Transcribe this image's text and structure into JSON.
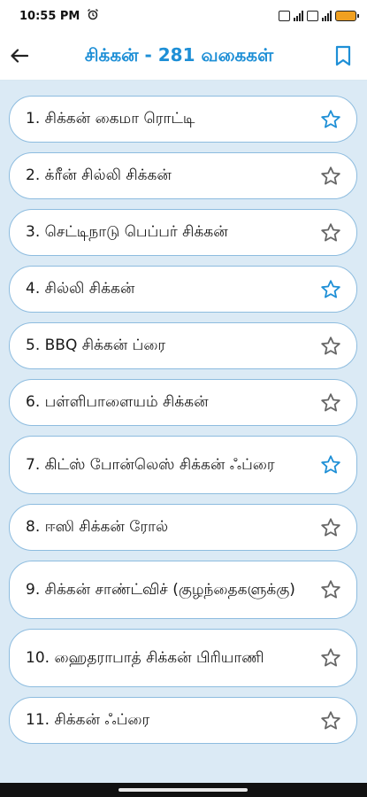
{
  "status_bar": {
    "time": "10:55 PM",
    "alarm_icon": "alarm-clock-icon"
  },
  "header": {
    "title": "சிக்கன் - 281 வகைகள்",
    "back_icon": "arrow-left-icon",
    "bookmark_icon": "bookmark-icon",
    "accent_color": "#1e8fd6"
  },
  "recipes": [
    {
      "label": "1. சிக்கன் கைமா ரொட்டி",
      "favorite": true
    },
    {
      "label": "2. க்ரீன் சில்லி சிக்கன்",
      "favorite": false
    },
    {
      "label": "3. செட்டிநாடு பெப்பர் சிக்கன்",
      "favorite": false
    },
    {
      "label": "4. சில்லி சிக்கன்",
      "favorite": true
    },
    {
      "label": "5. BBQ சிக்கன் ப்ரை",
      "favorite": false
    },
    {
      "label": "6. பள்ளிபாளையம் சிக்கன்",
      "favorite": false
    },
    {
      "label": "7. கிட்ஸ் போன்லெஸ் சிக்கன் ஃப்ரை",
      "favorite": true
    },
    {
      "label": "8. ஈஸி சிக்கன் ரோல்",
      "favorite": false
    },
    {
      "label": "9. சிக்கன் சாண்ட்விச் (குழந்தைகளுக்கு)",
      "favorite": false
    },
    {
      "label": "10. ஹைதராபாத் சிக்கன் பிரியாணி",
      "favorite": false
    },
    {
      "label": "11. சிக்கன் ஃப்ரை",
      "favorite": false
    }
  ],
  "colors": {
    "list_background": "#dbeaf5",
    "card_border": "#8dbcdf",
    "star_favorite": "#1e8fd6",
    "star_default": "#666666"
  }
}
